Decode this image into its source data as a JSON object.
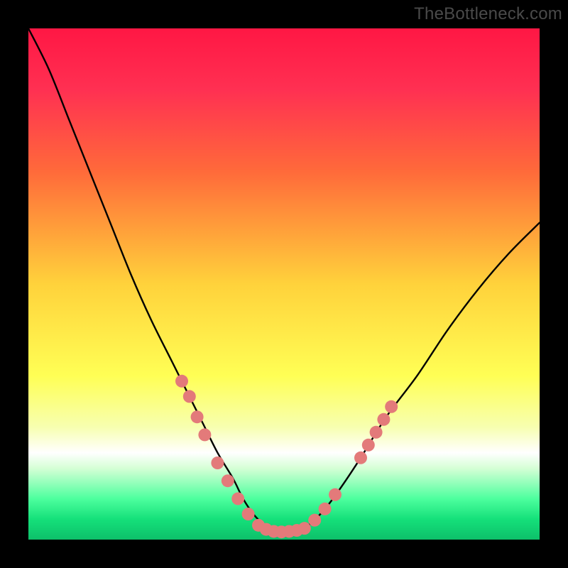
{
  "watermark": "TheBottleneck.com",
  "chart_data": {
    "type": "line",
    "title": "",
    "xlabel": "",
    "ylabel": "",
    "xlim": [
      0,
      100
    ],
    "ylim": [
      0,
      100
    ],
    "background_gradient_stops": [
      {
        "pct": 0.0,
        "color": "#ff1744"
      },
      {
        "pct": 12.0,
        "color": "#ff3052"
      },
      {
        "pct": 28.0,
        "color": "#ff6a3a"
      },
      {
        "pct": 50.0,
        "color": "#ffd23b"
      },
      {
        "pct": 68.0,
        "color": "#ffff55"
      },
      {
        "pct": 78.0,
        "color": "#f7ffb0"
      },
      {
        "pct": 83.0,
        "color": "#ffffff"
      },
      {
        "pct": 86.0,
        "color": "#d6ffd6"
      },
      {
        "pct": 92.0,
        "color": "#4dff9e"
      },
      {
        "pct": 96.0,
        "color": "#15e07a"
      },
      {
        "pct": 100.0,
        "color": "#0dc06a"
      }
    ],
    "series": [
      {
        "name": "bottleneck-curve",
        "stroke": "#000000",
        "stroke_width": 2.4,
        "x": [
          0,
          4,
          8,
          12,
          16,
          20,
          24,
          28,
          31,
          34,
          37,
          40,
          42,
          44,
          46,
          48,
          50,
          52,
          55,
          58,
          61,
          65,
          70,
          76,
          82,
          88,
          94,
          100
        ],
        "y": [
          100,
          92,
          82,
          72,
          62,
          52,
          43,
          35,
          29,
          23,
          17,
          12,
          8,
          5,
          3,
          1.8,
          1.6,
          1.8,
          3,
          6,
          10,
          16,
          24,
          32,
          41,
          49,
          56,
          62
        ]
      }
    ],
    "markers": {
      "color": "#e37a7a",
      "radius": 9,
      "points": [
        {
          "x": 30.0,
          "y": 31.0
        },
        {
          "x": 31.5,
          "y": 28.0
        },
        {
          "x": 33.0,
          "y": 24.0
        },
        {
          "x": 34.5,
          "y": 20.5
        },
        {
          "x": 37.0,
          "y": 15.0
        },
        {
          "x": 39.0,
          "y": 11.5
        },
        {
          "x": 41.0,
          "y": 8.0
        },
        {
          "x": 43.0,
          "y": 5.0
        },
        {
          "x": 45.0,
          "y": 2.8
        },
        {
          "x": 46.5,
          "y": 2.0
        },
        {
          "x": 48.0,
          "y": 1.6
        },
        {
          "x": 49.5,
          "y": 1.5
        },
        {
          "x": 51.0,
          "y": 1.6
        },
        {
          "x": 52.5,
          "y": 1.8
        },
        {
          "x": 54.0,
          "y": 2.2
        },
        {
          "x": 56.0,
          "y": 3.8
        },
        {
          "x": 58.0,
          "y": 6.0
        },
        {
          "x": 60.0,
          "y": 8.8
        },
        {
          "x": 65.0,
          "y": 16.0
        },
        {
          "x": 66.5,
          "y": 18.5
        },
        {
          "x": 68.0,
          "y": 21.0
        },
        {
          "x": 69.5,
          "y": 23.5
        },
        {
          "x": 71.0,
          "y": 26.0
        }
      ]
    }
  }
}
